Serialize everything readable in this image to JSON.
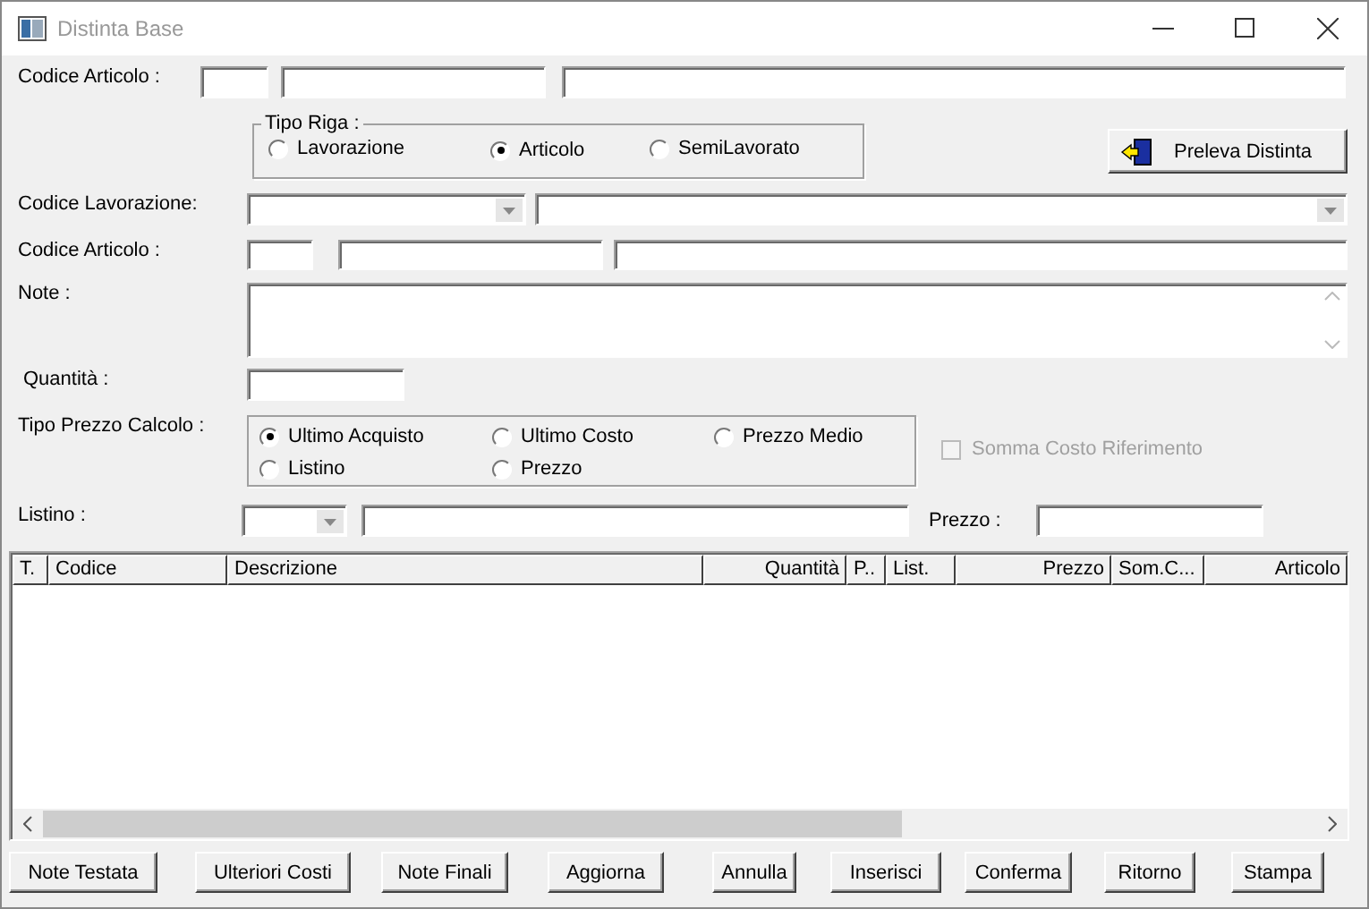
{
  "window": {
    "title": "Distinta Base"
  },
  "codice_articolo_top": {
    "label": "Codice Articolo :"
  },
  "tipo_riga": {
    "legend": "Tipo Riga :",
    "options": [
      {
        "label": "Lavorazione",
        "selected": false
      },
      {
        "label": "Articolo",
        "selected": true
      },
      {
        "label": "SemiLavorato",
        "selected": false
      }
    ]
  },
  "preleva_button": {
    "label": "Preleva Distinta"
  },
  "codice_lavorazione": {
    "label": "Codice Lavorazione:"
  },
  "codice_articolo": {
    "label": "Codice Articolo :"
  },
  "note": {
    "label": "Note :"
  },
  "quantita": {
    "label": "Quantità :"
  },
  "tipo_prezzo": {
    "label": "Tipo Prezzo Calcolo :",
    "options": [
      {
        "label": "Ultimo Acquisto",
        "selected": true
      },
      {
        "label": "Ultimo Costo",
        "selected": false
      },
      {
        "label": "Prezzo Medio",
        "selected": false
      },
      {
        "label": "Listino",
        "selected": false
      },
      {
        "label": "Prezzo",
        "selected": false
      }
    ]
  },
  "somma_costo": {
    "label": "Somma Costo Riferimento",
    "checked": false,
    "disabled": true
  },
  "listino": {
    "label": "Listino :"
  },
  "prezzo": {
    "label": "Prezzo :"
  },
  "table": {
    "columns": [
      {
        "label": "T."
      },
      {
        "label": "Codice"
      },
      {
        "label": "Descrizione"
      },
      {
        "label": "Quantità"
      },
      {
        "label": "P.."
      },
      {
        "label": "List."
      },
      {
        "label": "Prezzo"
      },
      {
        "label": "Som.C..."
      },
      {
        "label": "Articolo"
      }
    ]
  },
  "buttons": [
    "Note Testata",
    "Ulteriori Costi",
    "Note Finali",
    "Aggiorna",
    "Annulla",
    "Inserisci",
    "Conferma",
    "Ritorno",
    "Stampa"
  ]
}
